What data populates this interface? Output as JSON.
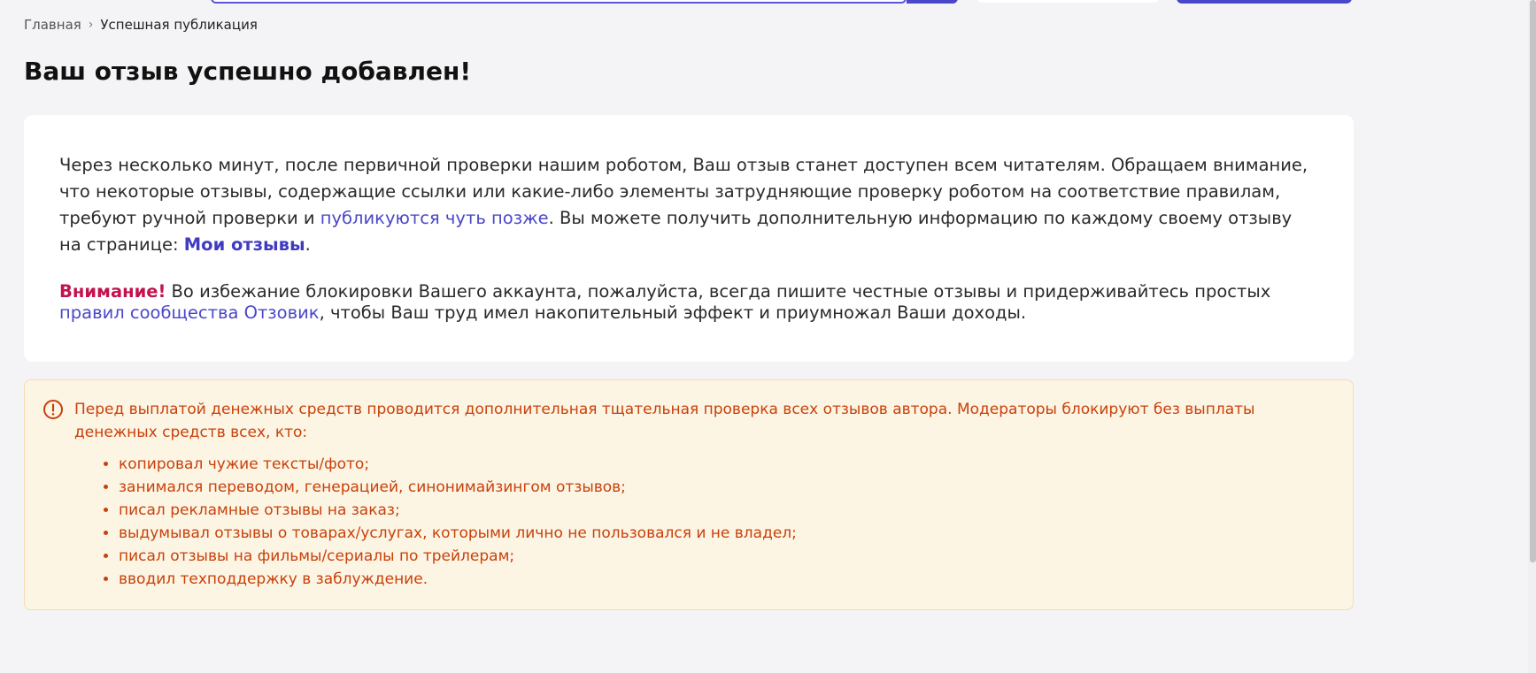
{
  "breadcrumb": {
    "home": "Главная",
    "separator": "›",
    "current": "Успешная публикация"
  },
  "page": {
    "title": "Ваш отзыв успешно добавлен!"
  },
  "info": {
    "para1_part1": "Через несколько минут, после первичной проверки нашим роботом, Ваш отзыв станет доступен всем читателям. Обращаем внимание, что некоторые отзывы, содержащие ссылки или какие-либо элементы затрудняющие проверку роботом на соответствие правилам, требуют ручной проверки и ",
    "para1_link": "публикуются чуть позже",
    "para1_part2": ". Вы можете получить дополнительную информацию по каждому своему отзыву на странице: ",
    "para1_my_reviews": "Мои отзывы",
    "para1_end": ".",
    "attention_label": "Внимание!",
    "para2_part1": " Во избежание блокировки Вашего аккаунта, пожалуйста, всегда пишите честные отзывы и придерживайтесь простых ",
    "para2_link": "правил сообщества Отзовик",
    "para2_part2": ", чтобы Ваш труд имел накопительный эффект и приумножал Ваши доходы."
  },
  "warning": {
    "text": "Перед выплатой денежных средств проводится дополнительная тщательная проверка всех отзывов автора. Модераторы блокируют без выплаты денежных средств всех, кто:",
    "items": [
      "копировал чужие тексты/фото;",
      "занимался переводом, генерацией, синонимайзингом отзывов;",
      "писал рекламные отзывы на заказ;",
      "выдумывал отзывы о товарах/услугах, которыми лично не пользовался и не владел;",
      "писал отзывы на фильмы/сериалы по трейлерам;",
      "вводил техподдержку в заблуждение."
    ]
  },
  "colors": {
    "accent": "#4a47c8",
    "attention": "#c4124f",
    "warning_text": "#c8410b",
    "warning_bg": "#fdf5e4"
  },
  "icons": {
    "warning": "exclamation-circle-icon"
  }
}
